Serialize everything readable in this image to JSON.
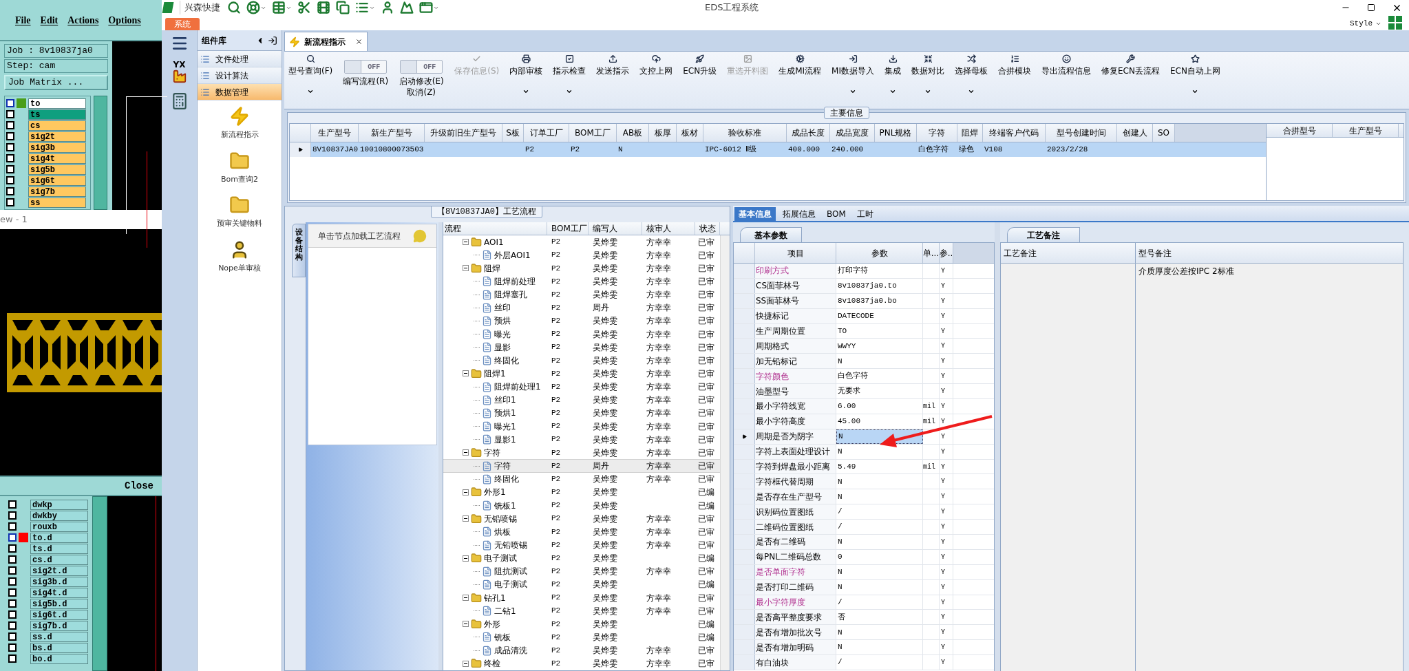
{
  "cam": {
    "menu": [
      "File",
      "Edit",
      "Actions",
      "Options"
    ],
    "job": "Job : 8v10837ja0",
    "step": "Step: cam",
    "matrix_button": "Job Matrix ...",
    "layers_top": [
      {
        "name": "to",
        "color": "#ffffff",
        "checked": false,
        "indicator": {
          "color": "#4a9e1a"
        }
      },
      {
        "name": "ts",
        "color": "#0f9f7f",
        "checked": false
      },
      {
        "name": "cs",
        "color": "#ffc860",
        "checked": false
      },
      {
        "name": "sig2t",
        "color": "#ffc860",
        "checked": false
      },
      {
        "name": "sig3b",
        "color": "#ffc860",
        "checked": false
      },
      {
        "name": "sig4t",
        "color": "#ffc860",
        "checked": false
      },
      {
        "name": "sig5b",
        "color": "#ffc860",
        "checked": false
      },
      {
        "name": "sig6t",
        "color": "#ffc860",
        "checked": false
      },
      {
        "name": "sig7b",
        "color": "#ffc860",
        "checked": false
      },
      {
        "name": "ss",
        "color": "#ffc860",
        "checked": false
      }
    ],
    "viewer_title": "ew - 1",
    "close_button": "Close",
    "layers_bottom": [
      {
        "name": "dwkp",
        "color": "#9edcdc",
        "checked": false
      },
      {
        "name": "dwkby",
        "color": "#9edcdc",
        "checked": false
      },
      {
        "name": "rouxb",
        "color": "#9edcdc",
        "checked": false
      },
      {
        "name": "to.d",
        "color": "#9edcdc",
        "checked": false,
        "indicator": {
          "color": "#ff0000"
        }
      },
      {
        "name": "ts.d",
        "color": "#9edcdc",
        "checked": false
      },
      {
        "name": "cs.d",
        "color": "#9edcdc",
        "checked": false
      },
      {
        "name": "sig2t.d",
        "color": "#9edcdc",
        "checked": false
      },
      {
        "name": "sig3b.d",
        "color": "#9edcdc",
        "checked": false
      },
      {
        "name": "sig4t.d",
        "color": "#9edcdc",
        "checked": false
      },
      {
        "name": "sig5b.d",
        "color": "#9edcdc",
        "checked": false
      },
      {
        "name": "sig6t.d",
        "color": "#9edcdc",
        "checked": false
      },
      {
        "name": "sig7b.d",
        "color": "#9edcdc",
        "checked": false
      },
      {
        "name": "ss.d",
        "color": "#9edcdc",
        "checked": false
      },
      {
        "name": "bs.d",
        "color": "#9edcdc",
        "checked": false
      },
      {
        "name": "bo.d",
        "color": "#9edcdc",
        "checked": false
      }
    ]
  },
  "app": {
    "brand": "兴森快捷",
    "title": "EDS工程系统",
    "style_menu": "Style",
    "system_tab": "系统",
    "yx_icon_text": "YX"
  },
  "components": {
    "title": "组件库",
    "categories": [
      {
        "label": "文件处理",
        "selected": false
      },
      {
        "label": "设计算法",
        "selected": false
      },
      {
        "label": "数据管理",
        "selected": true
      }
    ],
    "modules": [
      {
        "label": "新流程指示",
        "kind": "lightning"
      },
      {
        "label": "Bom查询2",
        "kind": "folder"
      },
      {
        "label": "预审关键物料",
        "kind": "folder"
      },
      {
        "label": "Nope单审核",
        "kind": "person"
      }
    ]
  },
  "doc_tabs": [
    {
      "label": "新流程指示",
      "selected": true
    }
  ],
  "toolbar": [
    {
      "kind": "button",
      "label": "型号查询(F)",
      "disabled": false,
      "dropdown": true
    },
    {
      "kind": "toggle",
      "label": "编写流程(R)",
      "switch_text": "OFF",
      "on": false
    },
    {
      "kind": "toggle",
      "label": "启动修改(E)\n取消(Z)",
      "switch_text": "OFF",
      "on": false
    },
    {
      "kind": "button",
      "label": "保存信息(S)",
      "disabled": true,
      "dropdown": false
    },
    {
      "kind": "button",
      "label": "内部审核",
      "disabled": false,
      "dropdown": true
    },
    {
      "kind": "button",
      "label": "指示检查",
      "disabled": false,
      "dropdown": true
    },
    {
      "kind": "button",
      "label": "发送指示",
      "disabled": false,
      "dropdown": false
    },
    {
      "kind": "button",
      "label": "文控上网",
      "disabled": false,
      "dropdown": false
    },
    {
      "kind": "button",
      "label": "ECN升级",
      "disabled": false,
      "dropdown": false
    },
    {
      "kind": "button",
      "label": "重选开料图",
      "disabled": true,
      "dropdown": false
    },
    {
      "kind": "button",
      "label": "生成MI流程",
      "disabled": false,
      "dropdown": false
    },
    {
      "kind": "button",
      "label": "MI数据导入",
      "disabled": false,
      "dropdown": true
    },
    {
      "kind": "button",
      "label": "集成",
      "disabled": false,
      "dropdown": true
    },
    {
      "kind": "button",
      "label": "数据对比",
      "disabled": false,
      "dropdown": true
    },
    {
      "kind": "button",
      "label": "选择母板",
      "disabled": false,
      "dropdown": true
    },
    {
      "kind": "button",
      "label": "合拼模块",
      "disabled": false,
      "dropdown": false
    },
    {
      "kind": "button",
      "label": "导出流程信息",
      "disabled": false,
      "dropdown": false
    },
    {
      "kind": "button",
      "label": "修复ECN丢流程",
      "disabled": false,
      "dropdown": false
    },
    {
      "kind": "button",
      "label": "ECN自动上网",
      "disabled": false,
      "dropdown": true
    }
  ],
  "main_info": {
    "title": "主要信息",
    "row_selected": true,
    "columns": [
      {
        "header": "生产型号",
        "value": "8V10837JA0"
      },
      {
        "header": "新生产型号",
        "value": "10010800073503"
      },
      {
        "header": "升级前旧生产型号"
      },
      {
        "header": "S板"
      },
      {
        "header": "订单工厂",
        "value": "P2"
      },
      {
        "header": "BOM工厂",
        "value": "P2"
      },
      {
        "header": "AB板",
        "value": "N"
      },
      {
        "header": "板厚"
      },
      {
        "header": "板材"
      },
      {
        "header": "验收标准",
        "value": "IPC-6012 Ⅱ级"
      },
      {
        "header": "成品长度",
        "value": "400.000"
      },
      {
        "header": "成品宽度",
        "value": "240.000"
      },
      {
        "header": "PNL规格"
      },
      {
        "header": "字符",
        "value": "白色字符"
      },
      {
        "header": "阻焊",
        "value": "绿色"
      },
      {
        "header": "终端客户代码",
        "value": "V108"
      },
      {
        "header": "型号创建时间",
        "value": "2023/2/28"
      },
      {
        "header": "创建人"
      },
      {
        "header": "SO"
      }
    ],
    "merge_columns": [
      "合拼型号",
      "生产型号"
    ]
  },
  "process": {
    "title": "【8V10837JA0】工艺流程",
    "side_tab": "设备结构",
    "hint": "单击节点加载工艺流程",
    "columns": [
      "流程",
      "BOM工厂",
      "编写人",
      "核审人",
      "状态"
    ],
    "tree": [
      {
        "name": "AOI1",
        "bom": "P2",
        "writer": "吴烨雯",
        "reviewer": "方幸幸",
        "status": "已审",
        "expanded": true,
        "selected": false,
        "children": [
          {
            "name": "外层AOI1",
            "bom": "P2",
            "writer": "吴烨雯",
            "reviewer": "方幸幸",
            "status": "已审",
            "selected": false
          }
        ]
      },
      {
        "name": "阻焊",
        "bom": "P2",
        "writer": "吴烨雯",
        "reviewer": "方幸幸",
        "status": "已审",
        "expanded": true,
        "selected": false,
        "children": [
          {
            "name": "阻焊前处理",
            "bom": "P2",
            "writer": "吴烨雯",
            "reviewer": "方幸幸",
            "status": "已审",
            "selected": false
          },
          {
            "name": "阻焊塞孔",
            "bom": "P2",
            "writer": "吴烨雯",
            "reviewer": "方幸幸",
            "status": "已审",
            "selected": false
          },
          {
            "name": "丝印",
            "bom": "P2",
            "writer": "周丹",
            "reviewer": "方幸幸",
            "status": "已审",
            "selected": false
          },
          {
            "name": "预烘",
            "bom": "P2",
            "writer": "吴烨雯",
            "reviewer": "方幸幸",
            "status": "已审",
            "selected": false
          },
          {
            "name": "曝光",
            "bom": "P2",
            "writer": "吴烨雯",
            "reviewer": "方幸幸",
            "status": "已审",
            "selected": false
          },
          {
            "name": "显影",
            "bom": "P2",
            "writer": "吴烨雯",
            "reviewer": "方幸幸",
            "status": "已审",
            "selected": false
          },
          {
            "name": "终固化",
            "bom": "P2",
            "writer": "吴烨雯",
            "reviewer": "方幸幸",
            "status": "已审",
            "selected": false
          }
        ]
      },
      {
        "name": "阻焊1",
        "bom": "P2",
        "writer": "吴烨雯",
        "reviewer": "方幸幸",
        "status": "已审",
        "expanded": true,
        "selected": false,
        "children": [
          {
            "name": "阻焊前处理1",
            "bom": "P2",
            "writer": "吴烨雯",
            "reviewer": "方幸幸",
            "status": "已审",
            "selected": false
          },
          {
            "name": "丝印1",
            "bom": "P2",
            "writer": "吴烨雯",
            "reviewer": "方幸幸",
            "status": "已审",
            "selected": false
          },
          {
            "name": "预烘1",
            "bom": "P2",
            "writer": "吴烨雯",
            "reviewer": "方幸幸",
            "status": "已审",
            "selected": false
          },
          {
            "name": "曝光1",
            "bom": "P2",
            "writer": "吴烨雯",
            "reviewer": "方幸幸",
            "status": "已审",
            "selected": false
          },
          {
            "name": "显影1",
            "bom": "P2",
            "writer": "吴烨雯",
            "reviewer": "方幸幸",
            "status": "已审",
            "selected": false
          }
        ]
      },
      {
        "name": "字符",
        "bom": "P2",
        "writer": "吴烨雯",
        "reviewer": "方幸幸",
        "status": "已审",
        "expanded": true,
        "selected": false,
        "children": [
          {
            "name": "字符",
            "bom": "P2",
            "writer": "周丹",
            "reviewer": "方幸幸",
            "status": "已审",
            "selected": true
          },
          {
            "name": "终固化",
            "bom": "P2",
            "writer": "吴烨雯",
            "reviewer": "方幸幸",
            "status": "已审",
            "selected": false
          }
        ]
      },
      {
        "name": "外形1",
        "bom": "P2",
        "writer": "吴烨雯",
        "status": "已编",
        "expanded": true,
        "selected": false,
        "children": [
          {
            "name": "铣板1",
            "bom": "P2",
            "writer": "吴烨雯",
            "status": "已编",
            "selected": false
          }
        ]
      },
      {
        "name": "无铅喷锡",
        "bom": "P2",
        "writer": "吴烨雯",
        "reviewer": "方幸幸",
        "status": "已审",
        "expanded": true,
        "selected": false,
        "children": [
          {
            "name": "烘板",
            "bom": "P2",
            "writer": "吴烨雯",
            "reviewer": "方幸幸",
            "status": "已审",
            "selected": false
          },
          {
            "name": "无铅喷锡",
            "bom": "P2",
            "writer": "吴烨雯",
            "reviewer": "方幸幸",
            "status": "已审",
            "selected": false
          }
        ]
      },
      {
        "name": "电子测试",
        "bom": "P2",
        "writer": "吴烨雯",
        "status": "已编",
        "expanded": true,
        "selected": false,
        "children": [
          {
            "name": "阻抗测试",
            "bom": "P2",
            "writer": "吴烨雯",
            "reviewer": "方幸幸",
            "status": "已审",
            "selected": false
          },
          {
            "name": "电子测试",
            "bom": "P2",
            "writer": "吴烨雯",
            "status": "已编",
            "selected": false
          }
        ]
      },
      {
        "name": "钻孔1",
        "bom": "P2",
        "writer": "吴烨雯",
        "reviewer": "方幸幸",
        "status": "已审",
        "expanded": true,
        "selected": false,
        "children": [
          {
            "name": "二钻1",
            "bom": "P2",
            "writer": "吴烨雯",
            "reviewer": "方幸幸",
            "status": "已审",
            "selected": false
          }
        ]
      },
      {
        "name": "外形",
        "bom": "P2",
        "writer": "吴烨雯",
        "status": "已编",
        "expanded": true,
        "selected": false,
        "children": [
          {
            "name": "铣板",
            "bom": "P2",
            "writer": "吴烨雯",
            "status": "已编",
            "selected": false
          },
          {
            "name": "成品清洗",
            "bom": "P2",
            "writer": "吴烨雯",
            "reviewer": "方幸幸",
            "status": "已审",
            "selected": false
          }
        ]
      },
      {
        "name": "终检",
        "bom": "P2",
        "writer": "吴烨雯",
        "reviewer": "方幸幸",
        "status": "已审",
        "expanded": true,
        "selected": false
      }
    ]
  },
  "details": {
    "tabs": [
      {
        "label": "基本信息",
        "selected": true
      },
      {
        "label": "拓展信息",
        "selected": false
      },
      {
        "label": "BOM",
        "selected": false
      },
      {
        "label": "工时",
        "selected": false
      }
    ],
    "params_tab": "基本参数",
    "params_columns": [
      "项目",
      "参数",
      "单...",
      "参.."
    ],
    "params": [
      {
        "item": "印刷方式",
        "value": "打印字符",
        "flag": "Y",
        "flagged": true,
        "selected": false
      },
      {
        "item": "CS面菲林号",
        "value": "8v10837ja0.to",
        "flag": "Y",
        "flagged": false,
        "selected": false
      },
      {
        "item": "SS面菲林号",
        "value": "8v10837ja0.bo",
        "flag": "Y",
        "flagged": false,
        "selected": false
      },
      {
        "item": "快捷标记",
        "value": "DATECODE",
        "flag": "Y",
        "flagged": false,
        "selected": false
      },
      {
        "item": "生产周期位置",
        "value": "TO",
        "flag": "Y",
        "flagged": false,
        "selected": false
      },
      {
        "item": "周期格式",
        "value": "WWYY",
        "flag": "Y",
        "flagged": false,
        "selected": false
      },
      {
        "item": "加无铅标记",
        "value": "N",
        "flag": "Y",
        "flagged": false,
        "selected": false
      },
      {
        "item": "字符颜色",
        "value": "白色字符",
        "flag": "Y",
        "flagged": true,
        "selected": false
      },
      {
        "item": "油墨型号",
        "value": "无要求",
        "flag": "Y",
        "flagged": false,
        "selected": false
      },
      {
        "item": "最小字符线宽",
        "value": "6.00",
        "unit": "mil",
        "flag": "Y",
        "flagged": false,
        "selected": false
      },
      {
        "item": "最小字符高度",
        "value": "45.00",
        "unit": "mil",
        "flag": "Y",
        "flagged": false,
        "selected": false
      },
      {
        "item": "周期是否为阴字",
        "value": "N",
        "flag": "Y",
        "flagged": false,
        "selected": true
      },
      {
        "item": "字符上表面处理设计",
        "value": "N",
        "flag": "Y",
        "flagged": false,
        "selected": false
      },
      {
        "item": "字符到焊盘最小距离",
        "value": "5.49",
        "unit": "mil",
        "flag": "Y",
        "flagged": false,
        "selected": false
      },
      {
        "item": "字符框代替周期",
        "value": "N",
        "flag": "Y",
        "flagged": false,
        "selected": false
      },
      {
        "item": "是否存在生产型号",
        "value": "N",
        "flag": "Y",
        "flagged": false,
        "selected": false
      },
      {
        "item": "识别码位置图纸",
        "value": "/",
        "flag": "Y",
        "flagged": false,
        "selected": false
      },
      {
        "item": "二维码位置图纸",
        "value": "/",
        "flag": "Y",
        "flagged": false,
        "selected": false
      },
      {
        "item": "是否有二维码",
        "value": "N",
        "flag": "Y",
        "flagged": false,
        "selected": false
      },
      {
        "item": "每PNL二维码总数",
        "value": "0",
        "flag": "Y",
        "flagged": false,
        "selected": false
      },
      {
        "item": "是否单面字符",
        "value": "N",
        "flag": "Y",
        "flagged": true,
        "selected": false
      },
      {
        "item": "是否打印二维码",
        "value": "N",
        "flag": "Y",
        "flagged": false,
        "selected": false
      },
      {
        "item": "最小字符厚度",
        "value": "/",
        "flag": "Y",
        "flagged": true,
        "selected": false
      },
      {
        "item": "是否高平整度要求",
        "value": "否",
        "flag": "Y",
        "flagged": false,
        "selected": false
      },
      {
        "item": "是否有增加批次号",
        "value": "N",
        "flag": "Y",
        "flagged": false,
        "selected": false
      },
      {
        "item": "是否有增加明码",
        "value": "N",
        "flag": "Y",
        "flagged": false,
        "selected": false
      },
      {
        "item": "有白油块",
        "value": "/",
        "flag": "Y",
        "flagged": false,
        "selected": false
      }
    ],
    "notes_tab": "工艺备注",
    "notes_columns": [
      "工艺备注",
      "型号备注"
    ],
    "model_note": "介质厚度公差按IPC 2标准"
  }
}
